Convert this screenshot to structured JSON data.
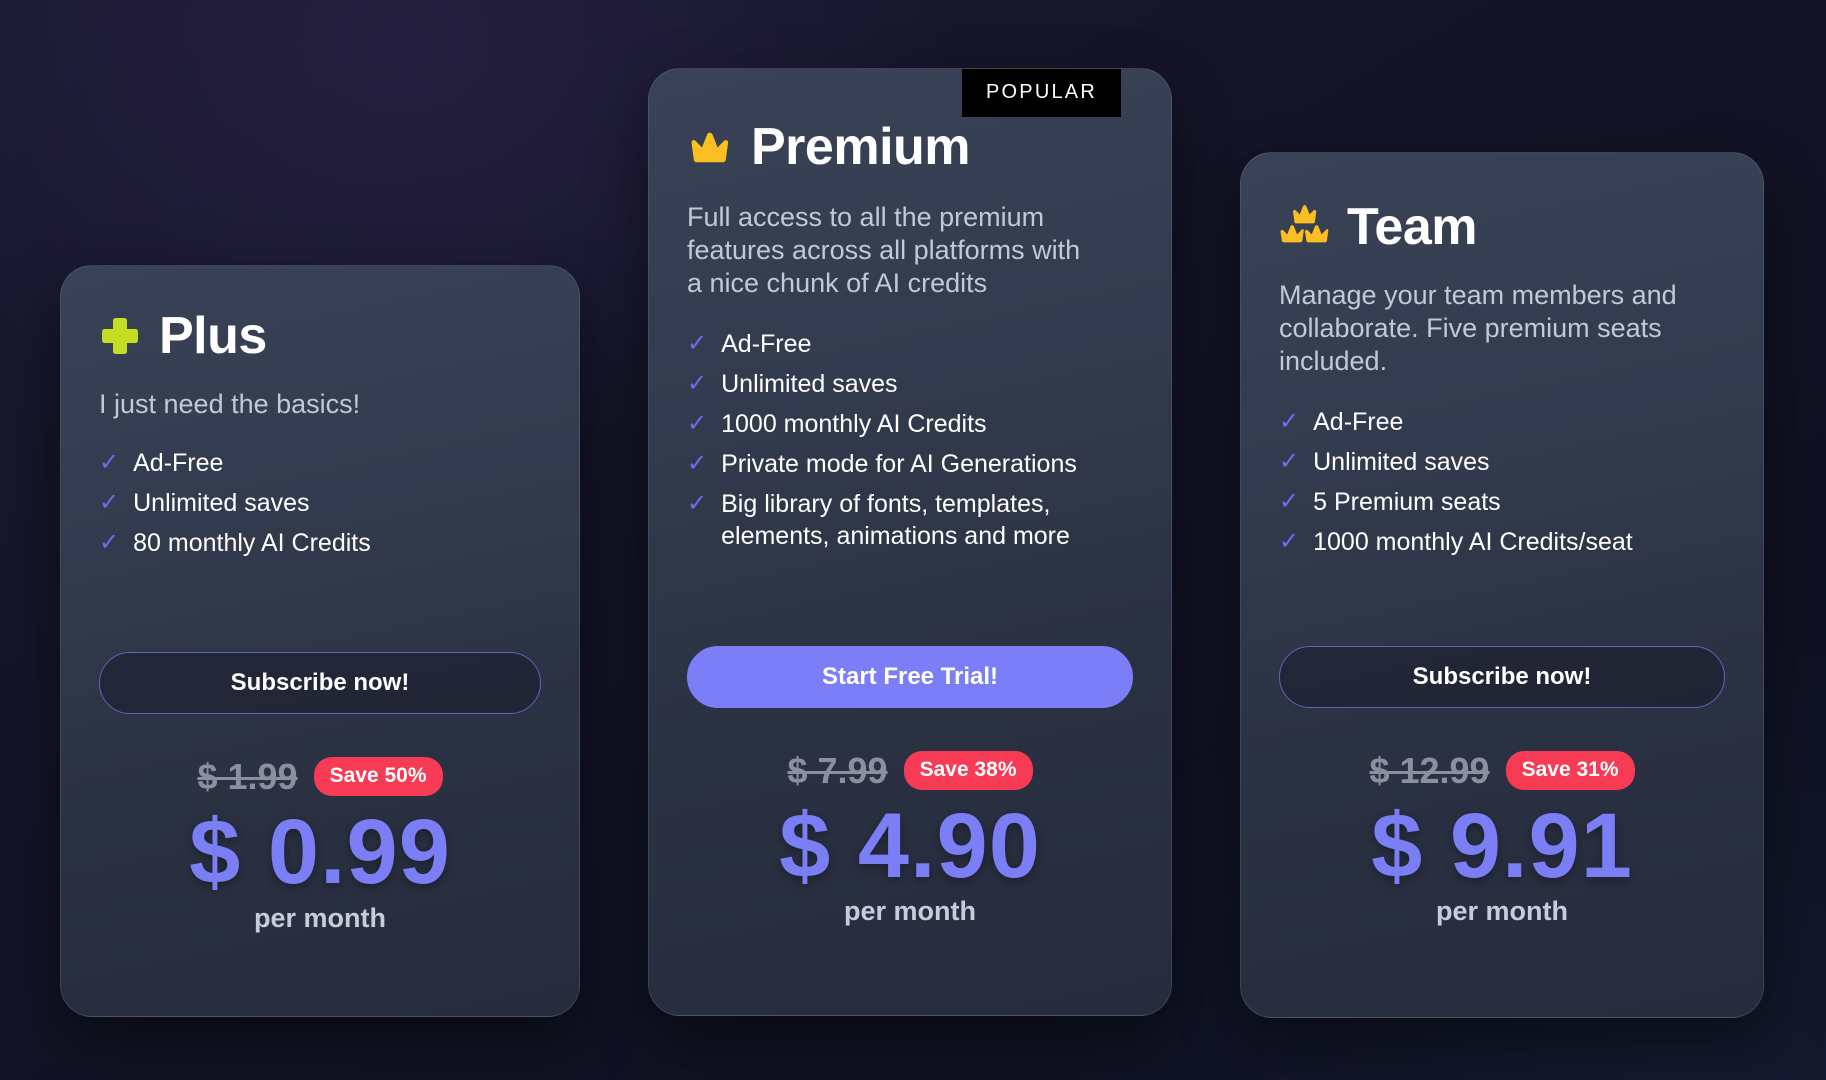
{
  "page": {
    "background_color": "#131426",
    "accent_color": "#7b7ef5",
    "save_badge_color": "#f73b55",
    "crown_color": "#fbbf24",
    "plus_color": "#c3dd22",
    "check_color": "#6b6ef0"
  },
  "plans": [
    {
      "id": "plus",
      "icon": "plus-icon",
      "name": "Plus",
      "description": "I just need the basics!",
      "features": [
        "Ad-Free",
        "Unlimited saves",
        "80 monthly AI Credits"
      ],
      "cta_label": "Subscribe now!",
      "cta_style": "outline",
      "old_price": "$ 1.99",
      "save_label": "Save 50%",
      "new_price": "$ 0.99",
      "period": "per month",
      "badge": null
    },
    {
      "id": "premium",
      "icon": "crown-icon",
      "name": "Premium",
      "description": "Full access to all the premium features across all platforms with a nice chunk of AI credits",
      "features": [
        "Ad-Free",
        "Unlimited saves",
        "1000 monthly AI Credits",
        "Private mode for AI Generations",
        "Big library of fonts, templates, elements, animations and more"
      ],
      "cta_label": "Start Free Trial!",
      "cta_style": "filled",
      "old_price": "$ 7.99",
      "save_label": "Save 38%",
      "new_price": "$ 4.90",
      "period": "per month",
      "badge": "POPULAR"
    },
    {
      "id": "team",
      "icon": "triple-crown-icon",
      "name": "Team",
      "description": "Manage your team members and collaborate. Five premium seats included.",
      "features": [
        "Ad-Free",
        "Unlimited saves",
        "5 Premium seats",
        "1000 monthly AI Credits/seat"
      ],
      "cta_label": "Subscribe now!",
      "cta_style": "outline",
      "old_price": "$ 12.99",
      "save_label": "Save 31%",
      "new_price": "$ 9.91",
      "period": "per month",
      "badge": null
    }
  ]
}
